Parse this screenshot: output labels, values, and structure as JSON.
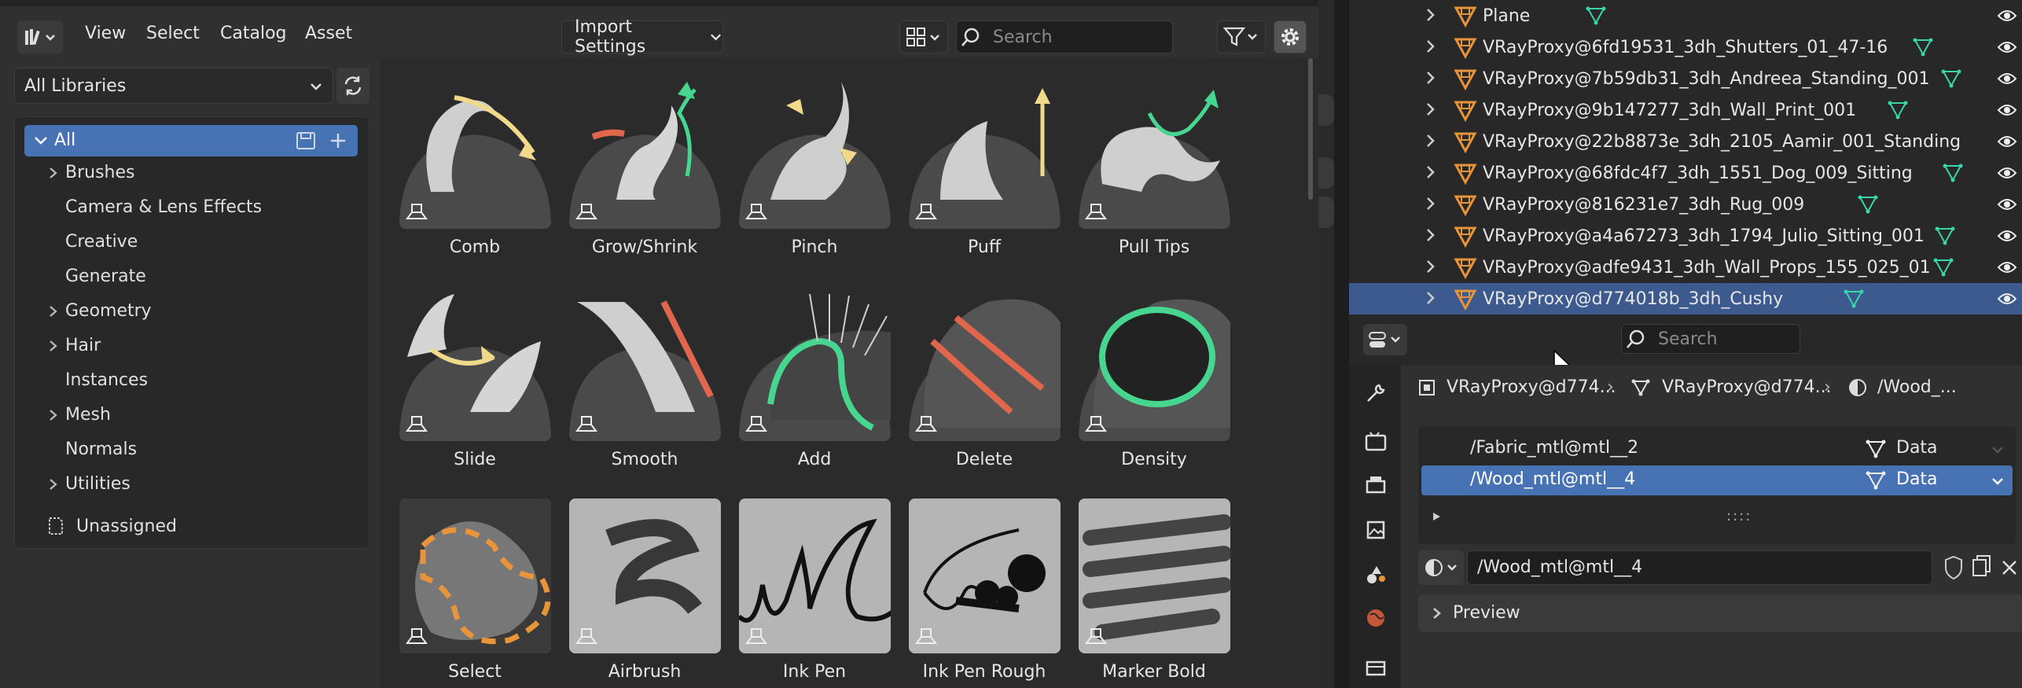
{
  "asset_browser": {
    "menus": [
      "View",
      "Select",
      "Catalog",
      "Asset"
    ],
    "import_settings": "Import Settings",
    "search_placeholder": "Search",
    "library_select": "All Libraries",
    "catalogs": {
      "all": "All",
      "items": [
        {
          "label": "Brushes",
          "expandable": true
        },
        {
          "label": "Camera & Lens Effects",
          "expandable": false
        },
        {
          "label": "Creative",
          "expandable": false
        },
        {
          "label": "Generate",
          "expandable": false
        },
        {
          "label": "Geometry",
          "expandable": true
        },
        {
          "label": "Hair",
          "expandable": true
        },
        {
          "label": "Instances",
          "expandable": false
        },
        {
          "label": "Mesh",
          "expandable": true
        },
        {
          "label": "Normals",
          "expandable": false
        },
        {
          "label": "Utilities",
          "expandable": true
        }
      ],
      "unassigned": "Unassigned"
    },
    "assets": [
      {
        "label": "Comb",
        "icon": "comb-brush-icon"
      },
      {
        "label": "Grow/Shrink",
        "icon": "grow-shrink-brush-icon"
      },
      {
        "label": "Pinch",
        "icon": "pinch-brush-icon"
      },
      {
        "label": "Puff",
        "icon": "puff-brush-icon"
      },
      {
        "label": "Pull Tips",
        "icon": "pull-tips-brush-icon"
      },
      {
        "label": "Slide",
        "icon": "slide-brush-icon"
      },
      {
        "label": "Smooth",
        "icon": "smooth-brush-icon"
      },
      {
        "label": "Add",
        "icon": "add-brush-icon"
      },
      {
        "label": "Delete",
        "icon": "delete-brush-icon"
      },
      {
        "label": "Density",
        "icon": "density-brush-icon"
      },
      {
        "label": "Select",
        "icon": "select-brush-icon"
      },
      {
        "label": "Airbrush",
        "icon": "airbrush-brush-icon"
      },
      {
        "label": "Ink Pen",
        "icon": "ink-pen-brush-icon"
      },
      {
        "label": "Ink Pen Rough",
        "icon": "ink-pen-rough-brush-icon"
      },
      {
        "label": "Marker Bold",
        "icon": "marker-bold-brush-icon"
      }
    ]
  },
  "outliner": {
    "rows": [
      {
        "name": "Plane",
        "selected": false
      },
      {
        "name": "VRayProxy@6fd19531_3dh_Shutters_01_47-16",
        "selected": false
      },
      {
        "name": "VRayProxy@7b59db31_3dh_Andreea_Standing_001",
        "selected": false
      },
      {
        "name": "VRayProxy@9b147277_3dh_Wall_Print_001",
        "selected": false
      },
      {
        "name": "VRayProxy@22b8873e_3dh_2105_Aamir_001_Standing",
        "selected": false
      },
      {
        "name": "VRayProxy@68fdc4f7_3dh_1551_Dog_009_Sitting",
        "selected": false
      },
      {
        "name": "VRayProxy@816231e7_3dh_Rug_009",
        "selected": false
      },
      {
        "name": "VRayProxy@a4a67273_3dh_1794_Julio_Sitting_001",
        "selected": false
      },
      {
        "name": "VRayProxy@adfe9431_3dh_Wall_Props_155_025_01",
        "selected": false
      },
      {
        "name": "VRayProxy@d774018b_3dh_Cushy",
        "selected": true
      }
    ]
  },
  "properties": {
    "search_placeholder": "Search",
    "breadcrumb": [
      "VRayProxy@d774...",
      "VRayProxy@d774...",
      "/Wood_..."
    ],
    "material_slots": [
      {
        "name": "/Fabric_mtl@mtl__2",
        "link": "Data",
        "selected": false
      },
      {
        "name": "/Wood_mtl@mtl__4",
        "link": "Data",
        "selected": true
      }
    ],
    "material_name": "/Wood_mtl@mtl__4",
    "preview_label": "Preview"
  },
  "colors": {
    "accent": "#4772b3",
    "orange": "#e8943a",
    "teal": "#38d6a9"
  }
}
